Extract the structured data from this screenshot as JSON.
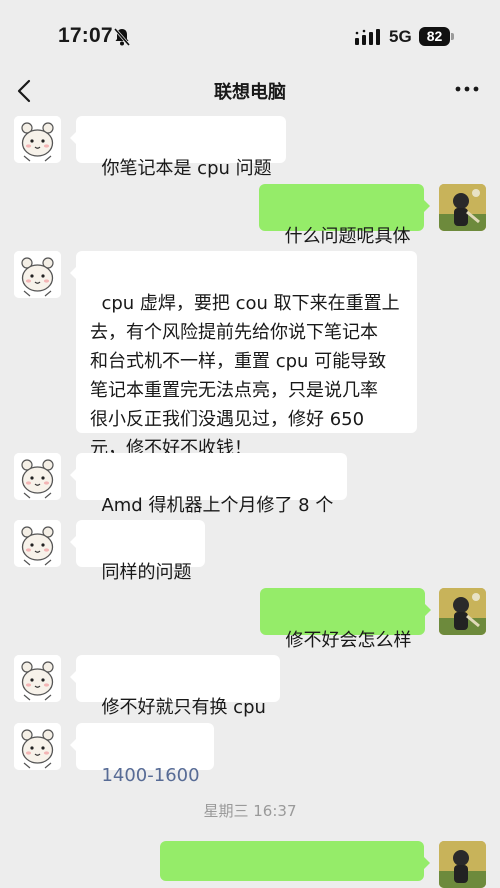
{
  "status_bar": {
    "time": "17:07",
    "network": "5G",
    "battery": "82"
  },
  "nav": {
    "title": "联想电脑"
  },
  "messages": [
    {
      "side": "left",
      "text": "你笔记本是 cpu 问题"
    },
    {
      "side": "right",
      "text": "什么问题呢具体"
    },
    {
      "side": "left",
      "text": "cpu 虚焊，要把 cou 取下来在重置上\n去，有个风险提前先给你说下笔记本\n和台式机不一样，重置 cpu 可能导致\n笔记本重置完无法点亮，只是说几率\n很小反正我们没遇见过，修好 650\n元，修不好不收钱！"
    },
    {
      "side": "left",
      "text": "Amd 得机器上个月修了 8 个"
    },
    {
      "side": "left",
      "text": "同样的问题"
    },
    {
      "side": "right",
      "text": "修不好会怎么样"
    },
    {
      "side": "left",
      "text": "修不好就只有换 cpu"
    },
    {
      "side": "left",
      "text": "1400-1600"
    }
  ],
  "timestamp": "星期三 16:37",
  "colors": {
    "background": "#ededed",
    "bubble_left": "#ffffff",
    "bubble_right": "#95ec69",
    "link": "#576b95"
  }
}
